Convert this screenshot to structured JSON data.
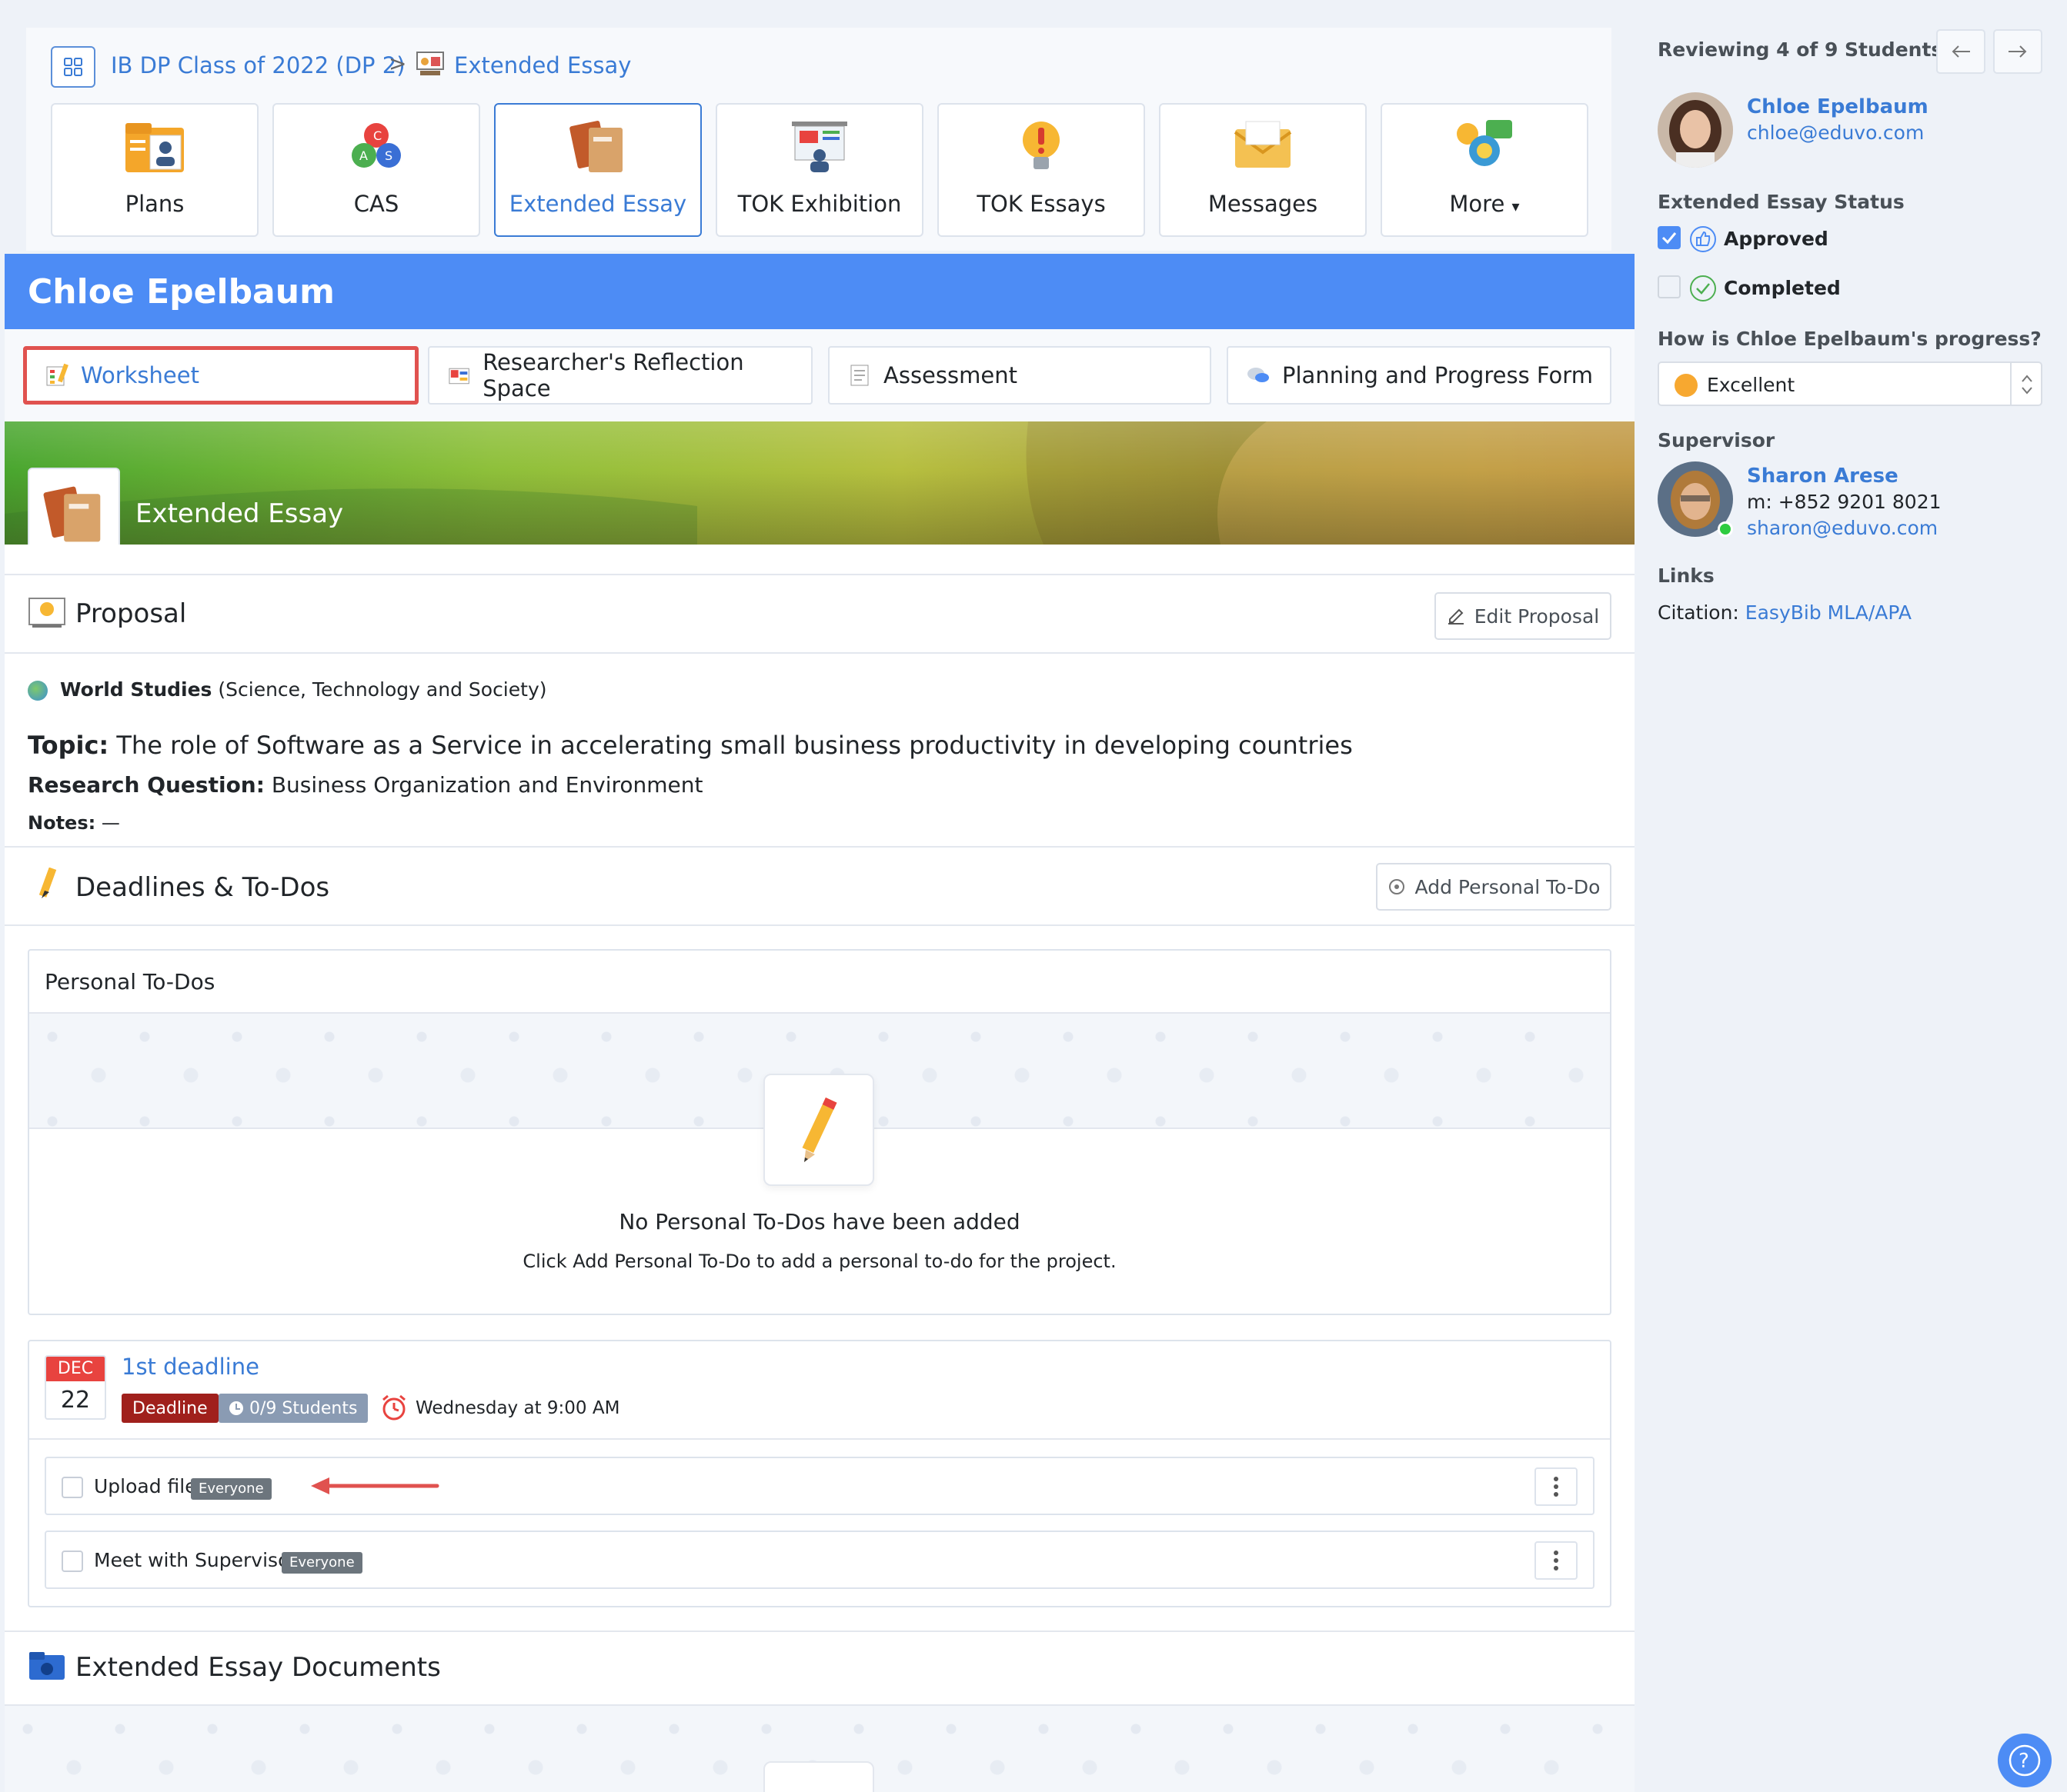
{
  "breadcrumb": {
    "class_name": "IB DP Class of 2022 (DP 2)",
    "separator": ">",
    "current": "Extended Essay"
  },
  "modules": [
    {
      "label": "Plans",
      "icon": "folder-person-icon"
    },
    {
      "label": "CAS",
      "icon": "cas-triangle-icon"
    },
    {
      "label": "Extended Essay",
      "icon": "books-icon",
      "active": true
    },
    {
      "label": "TOK Exhibition",
      "icon": "presentation-icon"
    },
    {
      "label": "TOK Essays",
      "icon": "lightbulb-exclamation-icon"
    },
    {
      "label": "Messages",
      "icon": "envelope-icon"
    },
    {
      "label": "More",
      "icon": "more-apps-icon"
    }
  ],
  "student": {
    "name": "Chloe Epelbaum",
    "email": "chloe@eduvo.com"
  },
  "subtabs": [
    {
      "label": "Worksheet",
      "active": true
    },
    {
      "label": "Researcher's Reflection Space"
    },
    {
      "label": "Assessment"
    },
    {
      "label": "Planning and Progress Form"
    }
  ],
  "hero": {
    "title": "Extended Essay"
  },
  "proposal": {
    "title": "Proposal",
    "edit_label": "Edit Proposal",
    "subject": "World Studies",
    "subject_detail": "(Science, Technology and Society)",
    "topic_label": "Topic:",
    "topic": "The role of Software as a Service in accelerating small business productivity in developing countries",
    "rq_label": "Research Question:",
    "rq": "Business Organization and Environment",
    "notes_label": "Notes:",
    "notes": "—"
  },
  "deadlines": {
    "title": "Deadlines & To-Dos",
    "add_label": "Add Personal To-Do",
    "personal_title": "Personal To-Dos",
    "empty_title": "No Personal To-Dos have been added",
    "empty_text": "Click Add Personal To-Do to add a personal to-do for the project.",
    "item": {
      "month": "DEC",
      "day": "22",
      "title": "1st deadline",
      "badge_type": "Deadline",
      "badge_students": "0/9 Students",
      "due": "Wednesday at 9:00 AM"
    },
    "tasks": [
      {
        "label": "Upload file",
        "tag": "Everyone"
      },
      {
        "label": "Meet with Supervisor",
        "tag": "Everyone"
      }
    ]
  },
  "documents": {
    "title": "Extended Essay Documents"
  },
  "sidebar": {
    "reviewing": "Reviewing 4 of 9 Students",
    "status_title": "Extended Essay Status",
    "status_approved": "Approved",
    "status_completed": "Completed",
    "progress_question": "How is Chloe Epelbaum's progress?",
    "progress_value": "Excellent",
    "supervisor_title": "Supervisor",
    "supervisor_name": "Sharon Arese",
    "supervisor_phone": "m: +852 9201 8021",
    "supervisor_email": "sharon@eduvo.com",
    "links_title": "Links",
    "citation_label": "Citation:",
    "citation_link": "EasyBib MLA/APA"
  },
  "colors": {
    "accent": "#4d8cf5",
    "link": "#3a7bd5",
    "deadline": "#a0201c",
    "highlight": "#e0524f"
  }
}
